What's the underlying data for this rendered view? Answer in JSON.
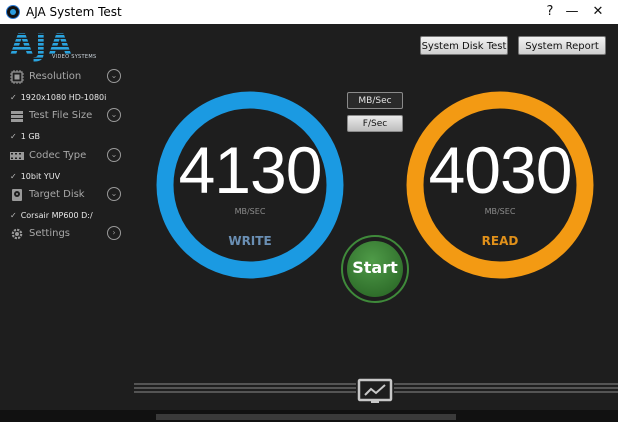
{
  "window": {
    "title": "AJA System Test",
    "help": "?",
    "minimize": "—",
    "close": "✕"
  },
  "logo": {
    "text": "AJA",
    "subtext": "VIDEO SYSTEMS",
    "color": "#2aa4df"
  },
  "header": {
    "disk_test_label": "System Disk Test",
    "report_label": "System Report"
  },
  "sidebar": {
    "items": [
      {
        "label": "Resolution",
        "value": "1920x1080 HD-1080i",
        "icon": "resolution-icon"
      },
      {
        "label": "Test File Size",
        "value": "1 GB",
        "icon": "file-stack-icon"
      },
      {
        "label": "Codec Type",
        "value": "10bit YUV",
        "icon": "film-icon"
      },
      {
        "label": "Target Disk",
        "value": "Corsair MP600 D:/",
        "icon": "disk-icon"
      },
      {
        "label": "Settings",
        "value": null,
        "icon": "gear-icon"
      }
    ]
  },
  "units": {
    "mbsec": "MB/Sec",
    "fsec": "F/Sec"
  },
  "write": {
    "value": "4130",
    "unit": "MB/SEC",
    "label": "WRITE",
    "color": "#1b9ae2",
    "label_color": "#6a8fb4"
  },
  "read": {
    "value": "4030",
    "unit": "MB/SEC",
    "label": "READ",
    "color": "#f39a13",
    "label_color": "#e0901a"
  },
  "start": {
    "label": "Start",
    "color": "#3f8a3a"
  }
}
